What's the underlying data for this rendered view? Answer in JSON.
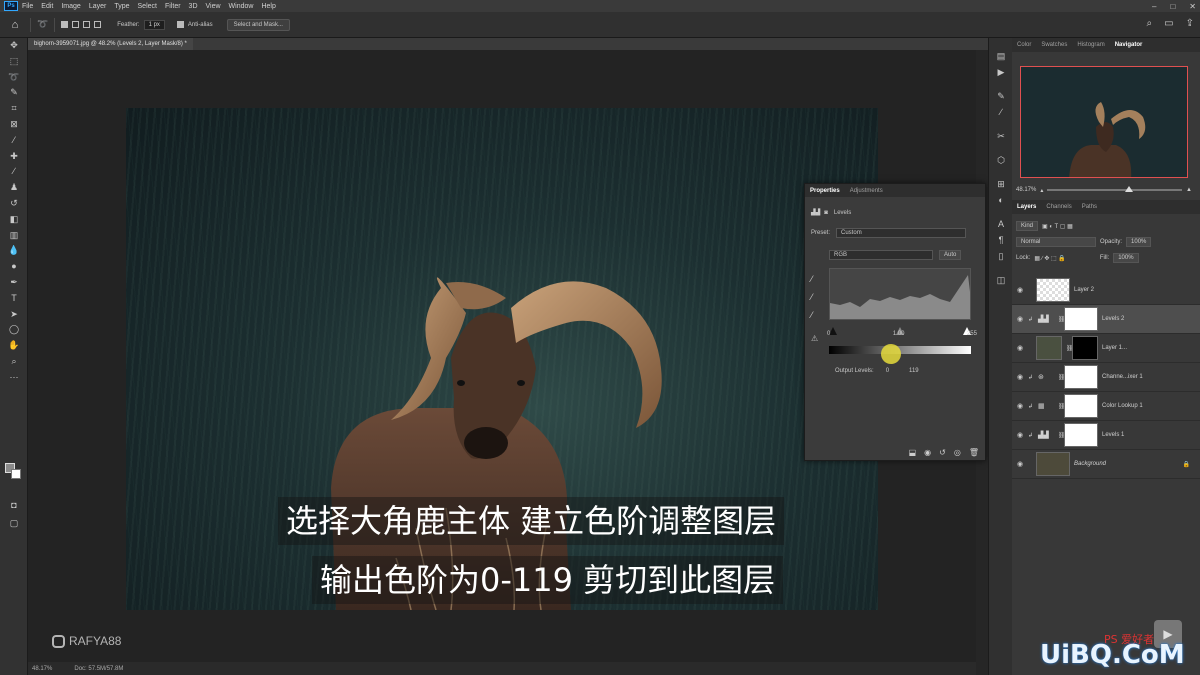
{
  "menu": [
    "File",
    "Edit",
    "Image",
    "Layer",
    "Type",
    "Select",
    "Filter",
    "3D",
    "View",
    "Window",
    "Help"
  ],
  "app_icon": "Ps",
  "options": {
    "feather_label": "Feather:",
    "feather_value": "1 px",
    "antialias": "Anti-alias",
    "select_mask": "Select and Mask..."
  },
  "doc_tab": "bighorn-3959071.jpg @ 48.2% (Levels 2, Layer Mask/8) *",
  "status": {
    "zoom": "48.17%",
    "doc": "Doc: 57.5M/57.8M"
  },
  "watermark": "RAFYA88",
  "subtitles": [
    "选择大角鹿主体 建立色阶调整图层",
    "输出色阶为0-119 剪切到此图层"
  ],
  "top_tabs": [
    "Color",
    "Swatches",
    "Histogram",
    "Navigator"
  ],
  "nav_zoom": "48.17%",
  "layers_tabs": [
    "Layers",
    "Channels",
    "Paths"
  ],
  "layer_controls": {
    "kind": "Kind",
    "blend": "Normal",
    "opacity_label": "Opacity:",
    "opacity": "100%",
    "lock_label": "Lock:",
    "fill_label": "Fill:",
    "fill": "100%"
  },
  "layers": [
    "Layer 2",
    "Levels 2",
    "Layer 1...",
    "Channe...ixer 1",
    "Color Lookup 1",
    "Levels 1",
    "Background"
  ],
  "properties": {
    "tabs": [
      "Properties",
      "Adjustments"
    ],
    "title": "Levels",
    "preset_label": "Preset:",
    "preset": "Custom",
    "channel": "RGB",
    "auto": "Auto",
    "in_black": "0",
    "in_gamma": "1.00",
    "in_white": "255",
    "output_label": "Output Levels:",
    "out_black": "0",
    "out_white": "119"
  },
  "logo": "UiBQ.CoM",
  "logo_small": "PS 爱好者"
}
